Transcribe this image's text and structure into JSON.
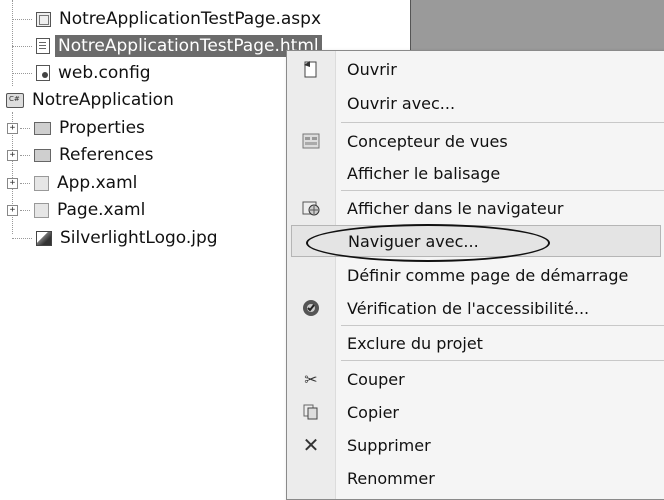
{
  "tree": {
    "items": [
      {
        "label": "NotreApplicationTestPage.aspx",
        "icon": "aspx-file-icon"
      },
      {
        "label": "NotreApplicationTestPage.html",
        "icon": "html-file-icon"
      },
      {
        "label": "web.config",
        "icon": "config-file-icon"
      },
      {
        "label": "NotreApplication",
        "icon": "csharp-project-icon"
      },
      {
        "label": "Properties",
        "icon": "properties-folder-icon"
      },
      {
        "label": "References",
        "icon": "references-folder-icon"
      },
      {
        "label": "App.xaml",
        "icon": "xaml-file-icon"
      },
      {
        "label": "Page.xaml",
        "icon": "xaml-file-icon"
      },
      {
        "label": "SilverlightLogo.jpg",
        "icon": "image-file-icon"
      }
    ],
    "expander_symbol": "+"
  },
  "menu": {
    "items": [
      {
        "label": "Ouvrir",
        "icon": "open-file-icon"
      },
      {
        "label": "Ouvrir avec..."
      },
      {
        "label": "Concepteur de vues",
        "icon": "view-designer-icon"
      },
      {
        "label": "Afficher le balisage"
      },
      {
        "label": "Afficher dans le navigateur",
        "icon": "view-in-browser-icon"
      },
      {
        "label": "Naviguer avec..."
      },
      {
        "label": "Définir comme page de démarrage"
      },
      {
        "label": "Vérification de l'accessibilité...",
        "icon": "accessibility-check-icon"
      },
      {
        "label": "Exclure du projet"
      },
      {
        "label": "Couper",
        "icon": "cut-icon",
        "glyph": "✂"
      },
      {
        "label": "Copier",
        "icon": "copy-icon"
      },
      {
        "label": "Supprimer",
        "icon": "delete-icon",
        "glyph": "✕"
      },
      {
        "label": "Renommer"
      }
    ]
  }
}
